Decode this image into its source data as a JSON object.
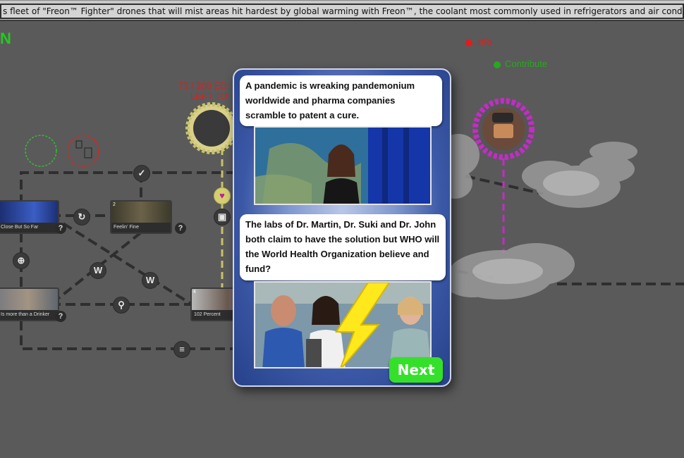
{
  "ticker": {
    "text": "s fleet of \"Freon™ Fighter\" drones that will mist areas hit hardest by global warming with Freon™, the coolant most commonly used in refrigerators and air conditioning uni"
  },
  "corner_letter": "N",
  "legend": {
    "info": "info",
    "contribute": "Contribute",
    "info_color": "#e21b1b",
    "contribute_color": "#28a81e"
  },
  "edit_counter": {
    "line1": "73 / 200 ED",
    "line2": "LEFT TO"
  },
  "nodes": [
    {
      "number": "",
      "caption": "Close But So Far"
    },
    {
      "number": "2",
      "caption": "Feelin' Fine"
    },
    {
      "number": "",
      "caption": "Is more than a Drinker"
    },
    {
      "number": "4",
      "caption": "102 Percent"
    }
  ],
  "help_mark": "?",
  "icons": {
    "target": "target-icon",
    "search": "magnify-icon",
    "wiki": "wikipedia-icon",
    "w_letter": "W",
    "heart": "heart-icon",
    "card": "card-icon",
    "contributor": "contributor-avatar-icon"
  },
  "modal": {
    "story_text": "A pandemic is wreaking pandemonium worldwide and pharma companies scramble to patent a cure.",
    "question_text": "The labs of Dr. Martin, Dr. Suki and Dr. John both claim to have the solution but WHO will the World Health Organization believe and fund?",
    "next_label": "Next",
    "next_color": "#35e02a"
  }
}
